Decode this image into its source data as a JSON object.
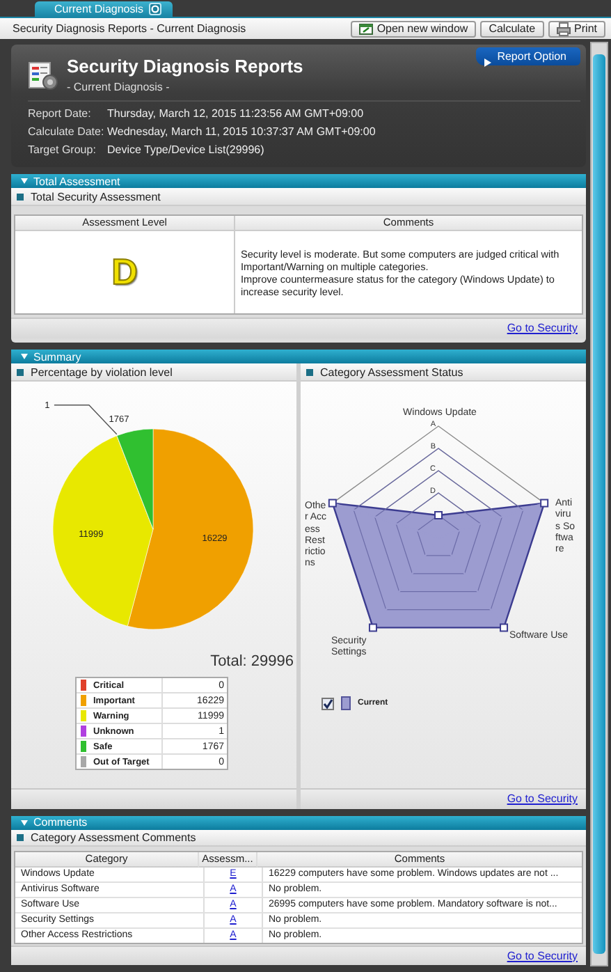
{
  "tab": {
    "label": "Current Diagnosis"
  },
  "toolbar": {
    "title": "Security Diagnosis Reports - Current Diagnosis",
    "buttons": [
      {
        "label": "Open new window",
        "kind": "window"
      },
      {
        "label": "Calculate",
        "kind": "plain"
      },
      {
        "label": "Print",
        "kind": "print"
      }
    ]
  },
  "header": {
    "title": "Security Diagnosis Reports",
    "subtitle": "- Current Diagnosis -",
    "option_button": "Report Option",
    "fields": [
      {
        "label": "Report Date:",
        "value": "Thursday, March 12, 2015 11:23:56 AM GMT+09:00"
      },
      {
        "label": "Calculate Date:",
        "value": "Wednesday, March 11, 2015 10:37:37 AM GMT+09:00"
      },
      {
        "label": "Target Group:",
        "value": "Device Type/Device List(29996)"
      }
    ]
  },
  "total_assessment": {
    "title": "Total Assessment",
    "subtitle": "Total Security Assessment",
    "columns": [
      "Assessment Level",
      "Comments"
    ],
    "level": "D",
    "comments": [
      "Security level is moderate. But some computers are judged critical with Important/Warning on multiple categories.",
      "Improve countermeasure status for the category (Windows Update) to increase security level."
    ],
    "link": "Go to Security"
  },
  "summary": {
    "title": "Summary",
    "violation": {
      "title": "Percentage by violation level",
      "chart_data": {
        "type": "pie",
        "categories": [
          "Critical",
          "Important",
          "Warning",
          "Unknown",
          "Safe",
          "Out of Target"
        ],
        "series": [
          {
            "values": [
              0,
              16229,
              11999,
              1,
              1767,
              0
            ]
          }
        ],
        "data_labels": true
      },
      "total": "Total: 29996",
      "legend": [
        {
          "value": "0",
          "color": "#e0402a"
        },
        {
          "value": "16229",
          "color": "#f0a000"
        },
        {
          "value": "11999",
          "color": "#e8e800"
        },
        {
          "value": "1",
          "color": "#b040e0"
        },
        {
          "value": "1767",
          "color": "#30c030"
        },
        {
          "value": "0",
          "color": "#a8a8a8"
        }
      ]
    },
    "category_status": {
      "title": "Category Assessment Status",
      "rings": [
        "A",
        "B",
        "C",
        "D"
      ],
      "axes": [
        {
          "label": "Windows Update",
          "level": 0.2
        },
        {
          "label": "Antivirus Software",
          "level": 1
        },
        {
          "label": "Software Use",
          "level": 1
        },
        {
          "label": "Security Settings",
          "level": 1
        },
        {
          "label": "Other Access Restrictions",
          "level": 1
        }
      ],
      "series": {
        "name": "Current",
        "color": "#9c9cd0",
        "checked": true
      }
    },
    "link": "Go to Security"
  },
  "comments": {
    "title": "Comments",
    "subtitle": "Category Assessment Comments",
    "columns": [
      "Category",
      "Assessm...",
      "Comments"
    ],
    "rows": [
      {
        "category": "Windows Update",
        "assessment": "E",
        "comment": "16229 computers have some problem. Windows updates are not ..."
      },
      {
        "category": "Antivirus Software",
        "assessment": "A",
        "comment": "No problem."
      },
      {
        "category": "Software Use",
        "assessment": "A",
        "comment": "26995 computers have some problem. Mandatory software is not..."
      },
      {
        "category": "Security Settings",
        "assessment": "A",
        "comment": "No problem."
      },
      {
        "category": "Other Access Restrictions",
        "assessment": "A",
        "comment": "No problem."
      }
    ],
    "link": "Go to Security"
  }
}
